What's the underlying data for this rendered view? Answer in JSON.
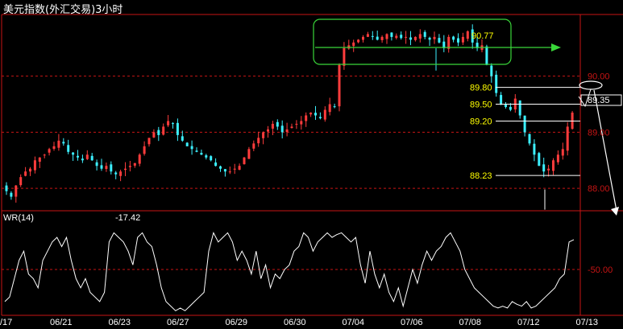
{
  "title": "美元指数(外汇交易)3小时",
  "indicator": {
    "name": "WR(14)",
    "value": "-17.42",
    "level_label": "-50.00"
  },
  "colors": {
    "up": "#ff3c3c",
    "down": "#3cf0ff",
    "grid": "#c81414",
    "wr_line": "#ffffff",
    "box": "#39d639",
    "annot": "#ffff00"
  },
  "chart_data": {
    "type": "candlestick",
    "x_ticks": [
      "/17",
      "06/21",
      "06/23",
      "06/27",
      "06/29",
      "06/30",
      "07/04",
      "07/06",
      "07/08",
      "07/12",
      "07/13"
    ],
    "price_labels": [
      "89.35",
      "90.00",
      "89.00",
      "88.00"
    ],
    "ylim": [
      87.6,
      91.1
    ],
    "annotations": [
      "90.77",
      "89.80",
      "89.50",
      "89.20",
      "88.23"
    ],
    "close_path": [
      87.95,
      87.85,
      88.05,
      88.2,
      88.3,
      88.35,
      88.5,
      88.55,
      88.6,
      88.7,
      88.75,
      88.85,
      88.8,
      88.65,
      88.6,
      88.55,
      88.5,
      88.6,
      88.5,
      88.4,
      88.35,
      88.4,
      88.3,
      88.25,
      88.3,
      88.35,
      88.4,
      88.45,
      88.6,
      88.75,
      88.9,
      89.0,
      88.95,
      89.1,
      89.2,
      89.15,
      88.95,
      88.85,
      88.75,
      88.7,
      88.65,
      88.6,
      88.55,
      88.5,
      88.4,
      88.35,
      88.3,
      88.3,
      88.35,
      88.4,
      88.55,
      88.7,
      88.8,
      88.9,
      89.0,
      89.05,
      89.15,
      89.1,
      89.0,
      89.05,
      89.1,
      89.15,
      89.2,
      89.3,
      89.35,
      89.3,
      89.25,
      89.4,
      89.5,
      89.45,
      90.2,
      90.5,
      90.55,
      90.6,
      90.65,
      90.7,
      90.75,
      90.7,
      90.65,
      90.7,
      90.75,
      90.7,
      90.72,
      90.68,
      90.7,
      90.65,
      90.7,
      90.75,
      90.7,
      90.65,
      90.7,
      90.6,
      90.5,
      90.7,
      90.65,
      90.6,
      90.7,
      90.8,
      90.6,
      90.5,
      90.55,
      90.2,
      90.0,
      89.7,
      89.5,
      89.45,
      89.4,
      89.6,
      89.3,
      89.0,
      88.8,
      88.6,
      88.4,
      88.3,
      88.35,
      88.5,
      88.6,
      88.7,
      89.1,
      89.35
    ],
    "wr_path": [
      -85,
      -80,
      -60,
      -40,
      -30,
      -55,
      -60,
      -70,
      -40,
      -30,
      -20,
      -15,
      -25,
      -15,
      -40,
      -60,
      -70,
      -60,
      -75,
      -80,
      -85,
      -75,
      -20,
      -10,
      -15,
      -20,
      -30,
      -45,
      -15,
      -10,
      -20,
      -25,
      -45,
      -70,
      -85,
      -90,
      -95,
      -92,
      -95,
      -90,
      -85,
      -80,
      -75,
      -30,
      -10,
      -20,
      -15,
      -10,
      -20,
      -40,
      -30,
      -40,
      -55,
      -30,
      -60,
      -45,
      -70,
      -55,
      -60,
      -50,
      -45,
      -30,
      -25,
      -10,
      -15,
      -30,
      -20,
      -15,
      -10,
      -15,
      -12,
      -10,
      -15,
      -20,
      -15,
      -45,
      -65,
      -30,
      -55,
      -70,
      -55,
      -75,
      -85,
      -70,
      -90,
      -70,
      -50,
      -65,
      -45,
      -30,
      -40,
      -30,
      -25,
      -15,
      -10,
      -20,
      -30,
      -50,
      -60,
      -70,
      -75,
      -80,
      -85,
      -90,
      -92,
      -90,
      -92,
      -85,
      -88,
      -90,
      -85,
      -92,
      -90,
      -85,
      -80,
      -75,
      -70,
      -60,
      -55,
      -20,
      -17.42
    ]
  }
}
